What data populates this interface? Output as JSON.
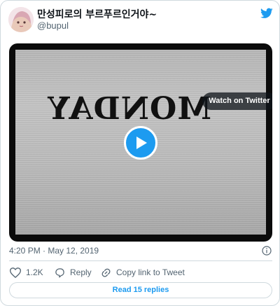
{
  "tweet": {
    "display_name": "만성피로의 부르푸르인거야~",
    "handle": "@bupul",
    "timestamp": "4:20 PM · May 12, 2019",
    "video_text": "MONDAY",
    "watch_label": "Watch on Twitter"
  },
  "actions": {
    "like_count": "1.2K",
    "reply_label": "Reply",
    "copy_label": "Copy link to Tweet"
  },
  "replies_button": "Read 15 replies",
  "icons": [
    "avatar",
    "twitter-bird-icon",
    "play-icon",
    "info-icon",
    "heart-icon",
    "reply-icon",
    "link-icon"
  ],
  "colors": {
    "accent": "#1d9bf0",
    "muted": "#536471",
    "border": "#cfd9de"
  }
}
